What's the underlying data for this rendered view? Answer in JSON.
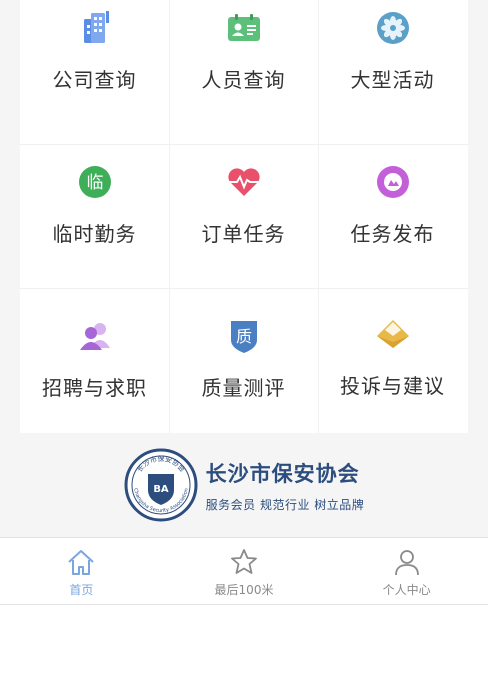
{
  "grid": {
    "items": [
      {
        "label": "公司查询",
        "icon": "company-building-icon"
      },
      {
        "label": "人员查询",
        "icon": "id-card-icon"
      },
      {
        "label": "大型活动",
        "icon": "flower-icon"
      },
      {
        "label": "临时勤务",
        "icon": "temp-duty-icon",
        "icon_text": "临"
      },
      {
        "label": "订单任务",
        "icon": "heartbeat-icon"
      },
      {
        "label": "任务发布",
        "icon": "publish-task-icon"
      },
      {
        "label": "招聘与求职",
        "icon": "recruit-people-icon"
      },
      {
        "label": "质量测评",
        "icon": "quality-shield-icon",
        "icon_text": "质"
      },
      {
        "label": "投诉与建议",
        "icon": "envelope-icon"
      }
    ]
  },
  "footer": {
    "org_name": "长沙市保安协会",
    "slogan": "服务会员 规范行业 树立品牌",
    "seal_top": "长沙市保安协会",
    "seal_center": "BA",
    "seal_bottom": "Changsha Security Association"
  },
  "tabbar": {
    "items": [
      {
        "label": "首页",
        "icon": "home-icon",
        "active": true
      },
      {
        "label": "最后100米",
        "icon": "star-icon",
        "active": false
      },
      {
        "label": "个人中心",
        "icon": "person-icon",
        "active": false
      }
    ]
  },
  "colors": {
    "company": "#5b8de6",
    "idcard": "#5cbf7a",
    "flower": "#5aa0c8",
    "temp": "#3fae58",
    "heart": "#e9506b",
    "publish": "#c35fd8",
    "recruit": "#a766d6",
    "quality": "#4a7fc4",
    "envelope": "#e8b948",
    "brand": "#2c4d7e",
    "tab_active": "#7aa6df"
  }
}
